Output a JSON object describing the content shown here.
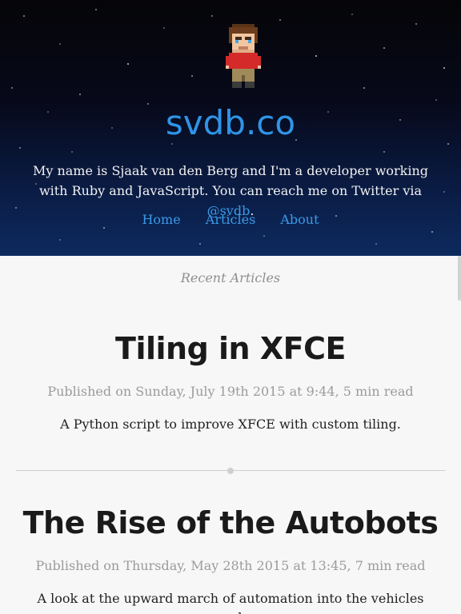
{
  "header": {
    "site_title": "svdb.co",
    "intro_text": "My name is Sjaak van den Berg and I'm a developer working with Ruby and JavaScript. You can reach me on Twitter via ",
    "twitter_handle": "@svdb",
    "intro_end": ".",
    "avatar_icon": "pixel-avatar-icon"
  },
  "nav": {
    "items": [
      {
        "label": "Home"
      },
      {
        "label": "Articles"
      },
      {
        "label": "About"
      }
    ]
  },
  "main": {
    "section_title": "Recent Articles",
    "posts": [
      {
        "title": "Tiling in XFCE",
        "meta": "Published on Sunday, July 19th 2015 at 9:44, 5 min read",
        "excerpt": "A Python script to improve XFCE with custom tiling."
      },
      {
        "title": "The Rise of the Autobots",
        "meta": "Published on Thursday, May 28th 2015 at 13:45, 7 min read",
        "excerpt": "A look at the upward march of automation into the vehicles around us."
      }
    ]
  },
  "colors": {
    "accent": "#2e95e8",
    "header_bg_top": "#050508",
    "header_bg_bottom": "#0d2a5e",
    "page_bg": "#f7f7f7"
  }
}
